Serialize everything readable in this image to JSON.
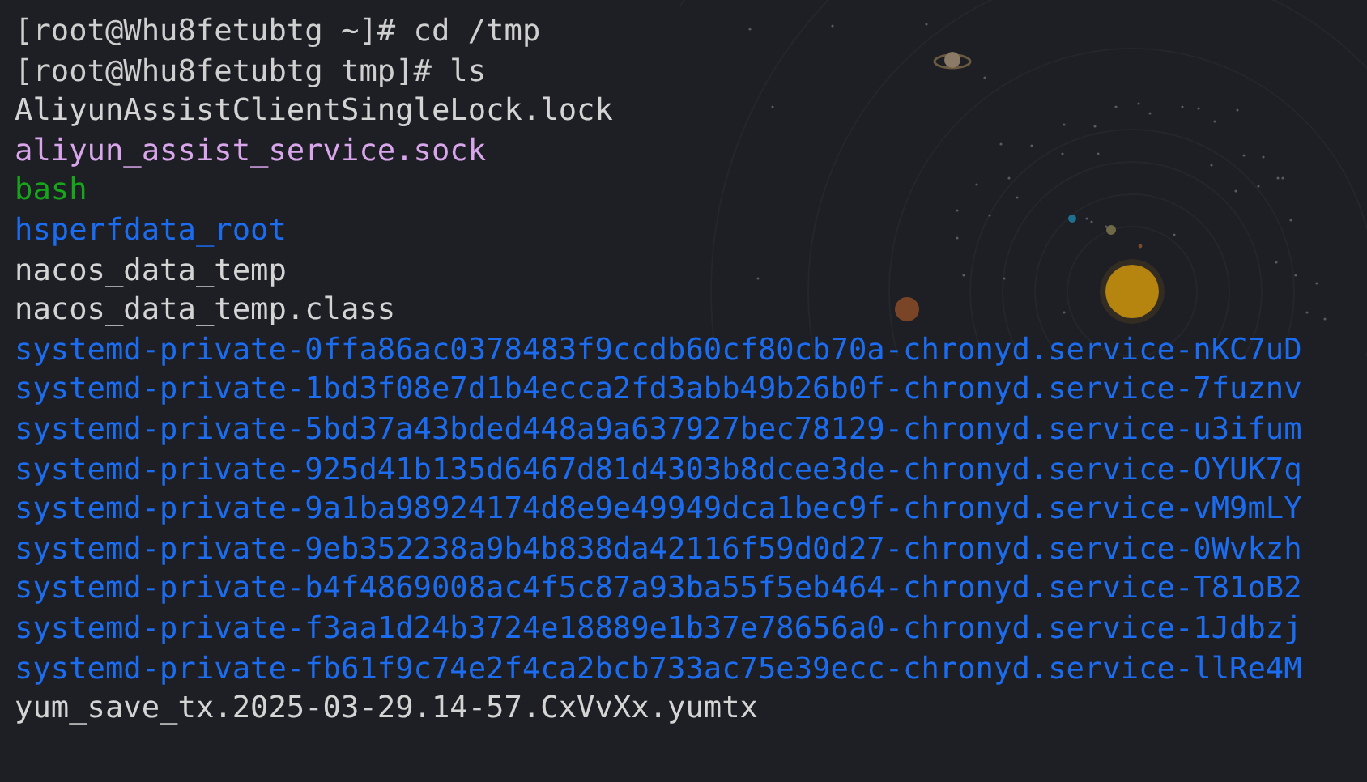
{
  "terminal": {
    "lines": [
      {
        "kind": "prompt",
        "text": "[root@Whu8fetubtg ~]# cd /tmp"
      },
      {
        "kind": "prompt",
        "text": "[root@Whu8fetubtg tmp]# ls"
      },
      {
        "kind": "file",
        "text": "AliyunAssistClientSingleLock.lock"
      },
      {
        "kind": "socket",
        "text": "aliyun_assist_service.sock"
      },
      {
        "kind": "executable",
        "text": "bash"
      },
      {
        "kind": "directory",
        "text": "hsperfdata_root"
      },
      {
        "kind": "file",
        "text": "nacos_data_temp"
      },
      {
        "kind": "file",
        "text": "nacos_data_temp.class"
      },
      {
        "kind": "directory",
        "text": "systemd-private-0ffa86ac0378483f9ccdb60cf80cb70a-chronyd.service-nKC7uD"
      },
      {
        "kind": "directory",
        "text": "systemd-private-1bd3f08e7d1b4ecca2fd3abb49b26b0f-chronyd.service-7fuznv"
      },
      {
        "kind": "directory",
        "text": "systemd-private-5bd37a43bded448a9a637927bec78129-chronyd.service-u3ifum"
      },
      {
        "kind": "directory",
        "text": "systemd-private-925d41b135d6467d81d4303b8dcee3de-chronyd.service-OYUK7q"
      },
      {
        "kind": "directory",
        "text": "systemd-private-9a1ba98924174d8e9e49949dca1bec9f-chronyd.service-vM9mLY"
      },
      {
        "kind": "directory",
        "text": "systemd-private-9eb352238a9b4b838da42116f59d0d27-chronyd.service-0Wvkzh"
      },
      {
        "kind": "directory",
        "text": "systemd-private-b4f4869008ac4f5c87a93ba55f5eb464-chronyd.service-T81oB2"
      },
      {
        "kind": "directory",
        "text": "systemd-private-f3aa1d24b3724e18889e1b37e78656a0-chronyd.service-1Jdbzj"
      },
      {
        "kind": "directory",
        "text": "systemd-private-fb61f9c74e2f4ca2bcb733ac75e39ecc-chronyd.service-llRe4M"
      },
      {
        "kind": "file",
        "text": "yum_save_tx.2025-03-29.14-57.CxVvXx.yumtx"
      }
    ]
  }
}
